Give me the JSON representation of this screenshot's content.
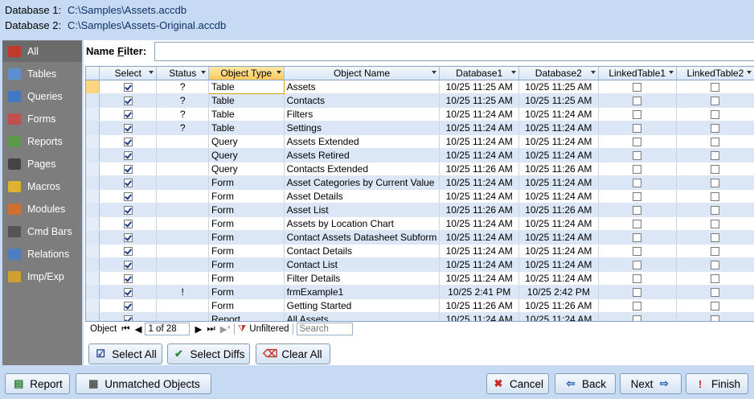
{
  "header": {
    "db1_label": "Database 1:",
    "db1_path": "C:\\Samples\\Assets.accdb",
    "db2_label": "Database 2:",
    "db2_path": "C:\\Samples\\Assets-Original.accdb"
  },
  "sidebar": {
    "items": [
      {
        "label": "All",
        "icon": "all-icon",
        "color": "#c0392b"
      },
      {
        "label": "Tables",
        "icon": "table-icon",
        "color": "#5a8fd0"
      },
      {
        "label": "Queries",
        "icon": "query-icon",
        "color": "#3f78c4"
      },
      {
        "label": "Forms",
        "icon": "form-icon",
        "color": "#c0504d"
      },
      {
        "label": "Reports",
        "icon": "report-icon",
        "color": "#5a9a4a"
      },
      {
        "label": "Pages",
        "icon": "page-icon",
        "color": "#444444"
      },
      {
        "label": "Macros",
        "icon": "macro-icon",
        "color": "#e0b030"
      },
      {
        "label": "Modules",
        "icon": "module-icon",
        "color": "#d07030"
      },
      {
        "label": "Cmd Bars",
        "icon": "cmdbar-icon",
        "color": "#555555"
      },
      {
        "label": "Relations",
        "icon": "relation-icon",
        "color": "#4a80c0"
      },
      {
        "label": "Imp/Exp",
        "icon": "impexp-icon",
        "color": "#d0a030"
      }
    ]
  },
  "filter": {
    "label_pre": "Name ",
    "label_key": "F",
    "label_post": "ilter:",
    "value": ""
  },
  "grid": {
    "columns": [
      "Select",
      "Status",
      "Object Type",
      "Object Name",
      "Database1",
      "Database2",
      "LinkedTable1",
      "LinkedTable2"
    ],
    "rows": [
      {
        "select": true,
        "status": "?",
        "type": "Table",
        "name": "Assets",
        "db1": "10/25 11:25 AM",
        "db2": "10/25 11:25 AM",
        "lt1": false,
        "lt2": false
      },
      {
        "select": true,
        "status": "?",
        "type": "Table",
        "name": "Contacts",
        "db1": "10/25 11:25 AM",
        "db2": "10/25 11:25 AM",
        "lt1": false,
        "lt2": false
      },
      {
        "select": true,
        "status": "?",
        "type": "Table",
        "name": "Filters",
        "db1": "10/25 11:24 AM",
        "db2": "10/25 11:24 AM",
        "lt1": false,
        "lt2": false
      },
      {
        "select": true,
        "status": "?",
        "type": "Table",
        "name": "Settings",
        "db1": "10/25 11:24 AM",
        "db2": "10/25 11:24 AM",
        "lt1": false,
        "lt2": false
      },
      {
        "select": true,
        "status": "",
        "type": "Query",
        "name": "Assets Extended",
        "db1": "10/25 11:24 AM",
        "db2": "10/25 11:24 AM",
        "lt1": false,
        "lt2": false
      },
      {
        "select": true,
        "status": "",
        "type": "Query",
        "name": "Assets Retired",
        "db1": "10/25 11:24 AM",
        "db2": "10/25 11:24 AM",
        "lt1": false,
        "lt2": false
      },
      {
        "select": true,
        "status": "",
        "type": "Query",
        "name": "Contacts Extended",
        "db1": "10/25 11:26 AM",
        "db2": "10/25 11:26 AM",
        "lt1": false,
        "lt2": false
      },
      {
        "select": true,
        "status": "",
        "type": "Form",
        "name": "Asset Categories by Current Value",
        "db1": "10/25 11:24 AM",
        "db2": "10/25 11:24 AM",
        "lt1": false,
        "lt2": false
      },
      {
        "select": true,
        "status": "",
        "type": "Form",
        "name": "Asset Details",
        "db1": "10/25 11:24 AM",
        "db2": "10/25 11:24 AM",
        "lt1": false,
        "lt2": false
      },
      {
        "select": true,
        "status": "",
        "type": "Form",
        "name": "Asset List",
        "db1": "10/25 11:26 AM",
        "db2": "10/25 11:26 AM",
        "lt1": false,
        "lt2": false
      },
      {
        "select": true,
        "status": "",
        "type": "Form",
        "name": "Assets by Location Chart",
        "db1": "10/25 11:24 AM",
        "db2": "10/25 11:24 AM",
        "lt1": false,
        "lt2": false
      },
      {
        "select": true,
        "status": "",
        "type": "Form",
        "name": "Contact Assets Datasheet Subform",
        "db1": "10/25 11:24 AM",
        "db2": "10/25 11:24 AM",
        "lt1": false,
        "lt2": false
      },
      {
        "select": true,
        "status": "",
        "type": "Form",
        "name": "Contact Details",
        "db1": "10/25 11:24 AM",
        "db2": "10/25 11:24 AM",
        "lt1": false,
        "lt2": false
      },
      {
        "select": true,
        "status": "",
        "type": "Form",
        "name": "Contact List",
        "db1": "10/25 11:24 AM",
        "db2": "10/25 11:24 AM",
        "lt1": false,
        "lt2": false
      },
      {
        "select": true,
        "status": "",
        "type": "Form",
        "name": "Filter Details",
        "db1": "10/25 11:24 AM",
        "db2": "10/25 11:24 AM",
        "lt1": false,
        "lt2": false
      },
      {
        "select": true,
        "status": "!",
        "type": "Form",
        "name": "frmExample1",
        "db1": "10/25 2:41 PM",
        "db2": "10/25 2:42 PM",
        "lt1": false,
        "lt2": false
      },
      {
        "select": true,
        "status": "",
        "type": "Form",
        "name": "Getting Started",
        "db1": "10/25 11:26 AM",
        "db2": "10/25 11:26 AM",
        "lt1": false,
        "lt2": false
      },
      {
        "select": true,
        "status": "",
        "type": "Report",
        "name": "All Assets",
        "db1": "10/25 11:24 AM",
        "db2": "10/25 11:24 AM",
        "lt1": false,
        "lt2": false
      }
    ]
  },
  "navbar": {
    "label": "Object",
    "position": "1 of 28",
    "filter_status": "Unfiltered",
    "search_placeholder": "Search"
  },
  "buttons": {
    "select_all": "Select All",
    "select_diffs": "Select Diffs",
    "clear_all": "Clear All",
    "report": "Report",
    "unmatched": "Unmatched Objects",
    "cancel": "Cancel",
    "back": "Back",
    "next": "Next",
    "finish": "Finish"
  }
}
